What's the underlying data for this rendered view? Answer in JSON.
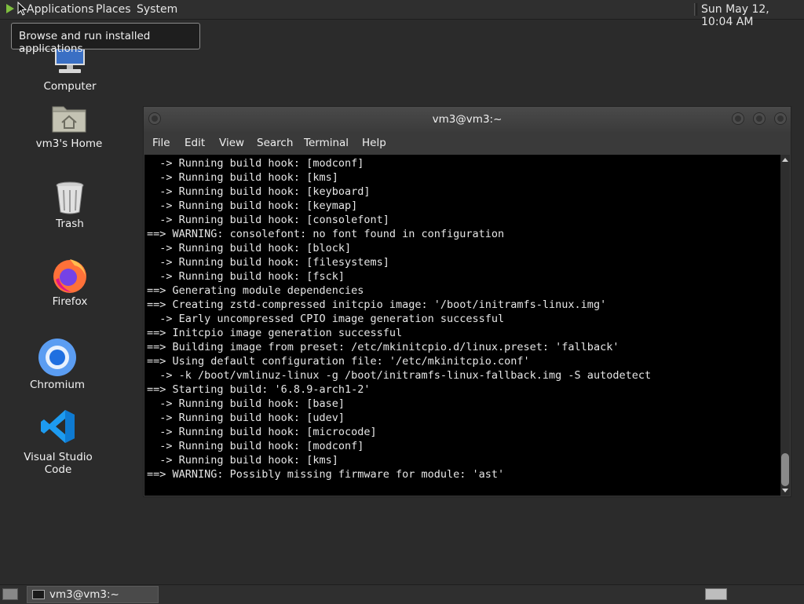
{
  "top_panel": {
    "menus": [
      "Applications",
      "Places",
      "System"
    ],
    "clock": "Sun May 12, 10:04 AM",
    "tooltip": "Browse and run installed applications"
  },
  "desktop_icons": [
    {
      "label": "Computer",
      "icon": "computer-icon"
    },
    {
      "label": "vm3's Home",
      "icon": "home-folder-icon"
    },
    {
      "label": "Trash",
      "icon": "trash-icon"
    },
    {
      "label": "Firefox",
      "icon": "firefox-icon"
    },
    {
      "label": "Chromium",
      "icon": "chromium-icon"
    },
    {
      "label": "Visual Studio Code",
      "icon": "vscode-icon"
    }
  ],
  "terminal": {
    "title": "vm3@vm3:~",
    "menu": [
      "File",
      "Edit",
      "View",
      "Search",
      "Terminal",
      "Help"
    ],
    "lines": [
      "  -> Running build hook: [modconf]",
      "  -> Running build hook: [kms]",
      "  -> Running build hook: [keyboard]",
      "  -> Running build hook: [keymap]",
      "  -> Running build hook: [consolefont]",
      "==> WARNING: consolefont: no font found in configuration",
      "  -> Running build hook: [block]",
      "  -> Running build hook: [filesystems]",
      "  -> Running build hook: [fsck]",
      "==> Generating module dependencies",
      "==> Creating zstd-compressed initcpio image: '/boot/initramfs-linux.img'",
      "  -> Early uncompressed CPIO image generation successful",
      "==> Initcpio image generation successful",
      "==> Building image from preset: /etc/mkinitcpio.d/linux.preset: 'fallback'",
      "==> Using default configuration file: '/etc/mkinitcpio.conf'",
      "  -> -k /boot/vmlinuz-linux -g /boot/initramfs-linux-fallback.img -S autodetect",
      "==> Starting build: '6.8.9-arch1-2'",
      "  -> Running build hook: [base]",
      "  -> Running build hook: [udev]",
      "  -> Running build hook: [microcode]",
      "  -> Running build hook: [modconf]",
      "  -> Running build hook: [kms]",
      "==> WARNING: Possibly missing firmware for module: 'ast'"
    ]
  },
  "taskbar": {
    "task_label": "vm3@vm3:~"
  }
}
